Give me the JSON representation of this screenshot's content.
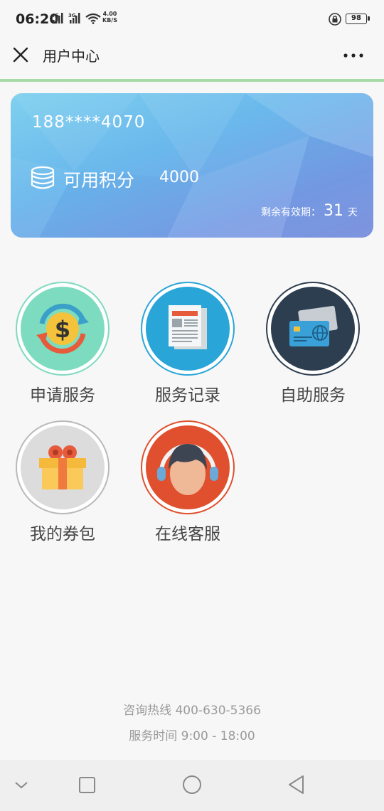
{
  "status_bar": {
    "time": "06:20",
    "network_1": "4G",
    "network_2": "3G",
    "speed_value": "4.00",
    "speed_unit": "KB/S",
    "battery": "98"
  },
  "header": {
    "title": "用户中心"
  },
  "card": {
    "phone": "188****4070",
    "points_label": "可用积分",
    "points_value": "4000",
    "expire_label": "剩余有效期：",
    "expire_days": "31",
    "expire_unit": "天"
  },
  "menu": [
    {
      "label": "申请服务",
      "icon": "exchange-dollar-icon"
    },
    {
      "label": "服务记录",
      "icon": "newspaper-icon"
    },
    {
      "label": "自助服务",
      "icon": "credit-card-icon"
    },
    {
      "label": "我的券包",
      "icon": "gift-box-icon"
    },
    {
      "label": "在线客服",
      "icon": "headset-agent-icon"
    }
  ],
  "footer": {
    "hotline_label": "咨询热线",
    "hotline_number": "400-630-5366",
    "hours_label": "服务时间",
    "hours_value": "9:00 - 18:00"
  },
  "colors": {
    "card_gradient_start": "#7fd0ef",
    "card_gradient_end": "#8799e2",
    "header_divider": "#a8dba8"
  }
}
